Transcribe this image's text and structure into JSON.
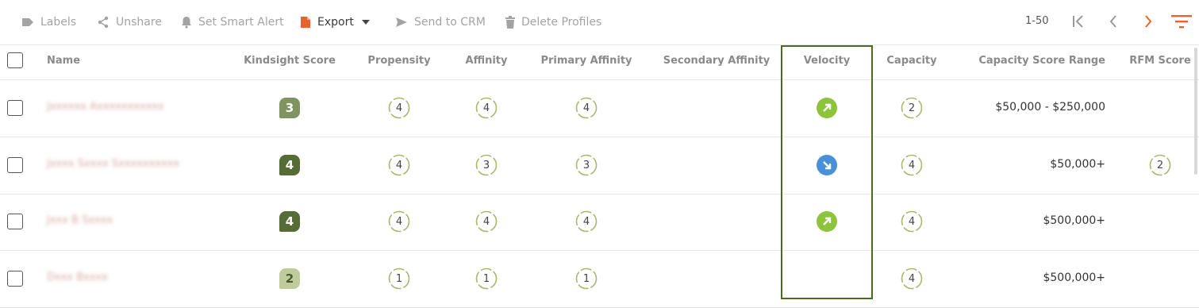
{
  "toolbar": {
    "labels": "Labels",
    "unshare": "Unshare",
    "smart_alert": "Set Smart Alert",
    "export": "Export",
    "send_crm": "Send to CRM",
    "delete_profiles": "Delete Profiles"
  },
  "pager": {
    "range": "1-50"
  },
  "colors": {
    "accent": "#e8632f",
    "highlight_border": "#4a6b22",
    "velocity_up": "#8cc43c",
    "velocity_down": "#4a90d9"
  },
  "columns": {
    "name": "Name",
    "kindsight": "Kindsight Score",
    "propensity": "Propensity",
    "affinity": "Affinity",
    "primary_affinity": "Primary Affinity",
    "secondary_affinity": "Secondary Affinity",
    "velocity": "Velocity",
    "capacity": "Capacity",
    "capacity_range": "Capacity Score Range",
    "rfm": "RFM Score"
  },
  "rows": [
    {
      "name": "Jxxxxxx Axxxxxxxxxxx",
      "kindsight": "3",
      "kindsight_color": "#7f9461",
      "propensity": "4",
      "affinity": "4",
      "primary_affinity": "4",
      "velocity": "up",
      "capacity": "2",
      "capacity_range": "$50,000 - $250,000",
      "rfm": ""
    },
    {
      "name": "Jxxxx Sxxxx Sxxxxxxxxxx",
      "kindsight": "4",
      "kindsight_color": "#566b35",
      "propensity": "4",
      "affinity": "3",
      "primary_affinity": "3",
      "velocity": "down",
      "capacity": "4",
      "capacity_range": "$50,000+",
      "rfm": "2"
    },
    {
      "name": "Jxxx B Sxxxx",
      "kindsight": "4",
      "kindsight_color": "#566b35",
      "propensity": "4",
      "affinity": "4",
      "primary_affinity": "4",
      "velocity": "up",
      "capacity": "4",
      "capacity_range": "$500,000+",
      "rfm": ""
    },
    {
      "name": "Dxxx Bxxxx",
      "kindsight": "2",
      "kindsight_color": "#c0cb9c",
      "kindsight_text_color": "#4a5a2a",
      "propensity": "1",
      "affinity": "1",
      "primary_affinity": "1",
      "velocity": "",
      "capacity": "4",
      "capacity_range": "$500,000+",
      "rfm": ""
    }
  ]
}
